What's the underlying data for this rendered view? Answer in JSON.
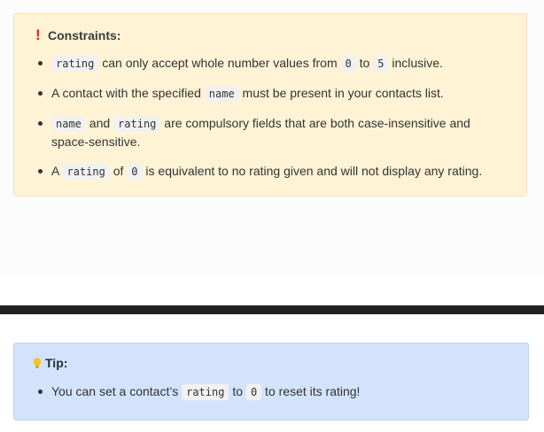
{
  "constraints": {
    "title": "Constraints:",
    "items": {
      "i0": {
        "code1": "rating",
        "t1": " can only accept whole number values from ",
        "code2": "0",
        "t2": " to ",
        "code3": "5",
        "t3": " inclusive."
      },
      "i1": {
        "t1": "A contact with the specified ",
        "code1": "name",
        "t2": " must be present in your contacts list."
      },
      "i2": {
        "code1": "name",
        "t1": " and ",
        "code2": "rating",
        "t2": " are compulsory fields that are both case-insensitive and space-sensitive."
      },
      "i3": {
        "t1": "A ",
        "code1": "rating",
        "t2": " of ",
        "code2": "0",
        "t3": " is equivalent to no rating given and will not display any rating."
      }
    }
  },
  "tip": {
    "title": "Tip:",
    "item": {
      "t1": "You can set a contact’s ",
      "code1": "rating",
      "t2": " to ",
      "code2": "0",
      "t3": " to reset its rating!"
    }
  },
  "colors": {
    "constraints_bg": "#fff3d6",
    "tip_bg": "#d3e3fb",
    "alert_red": "#e0281b",
    "divider": "#222222"
  },
  "icons": {
    "constraints": "exclamation-icon",
    "tip": "lightbulb-icon"
  }
}
